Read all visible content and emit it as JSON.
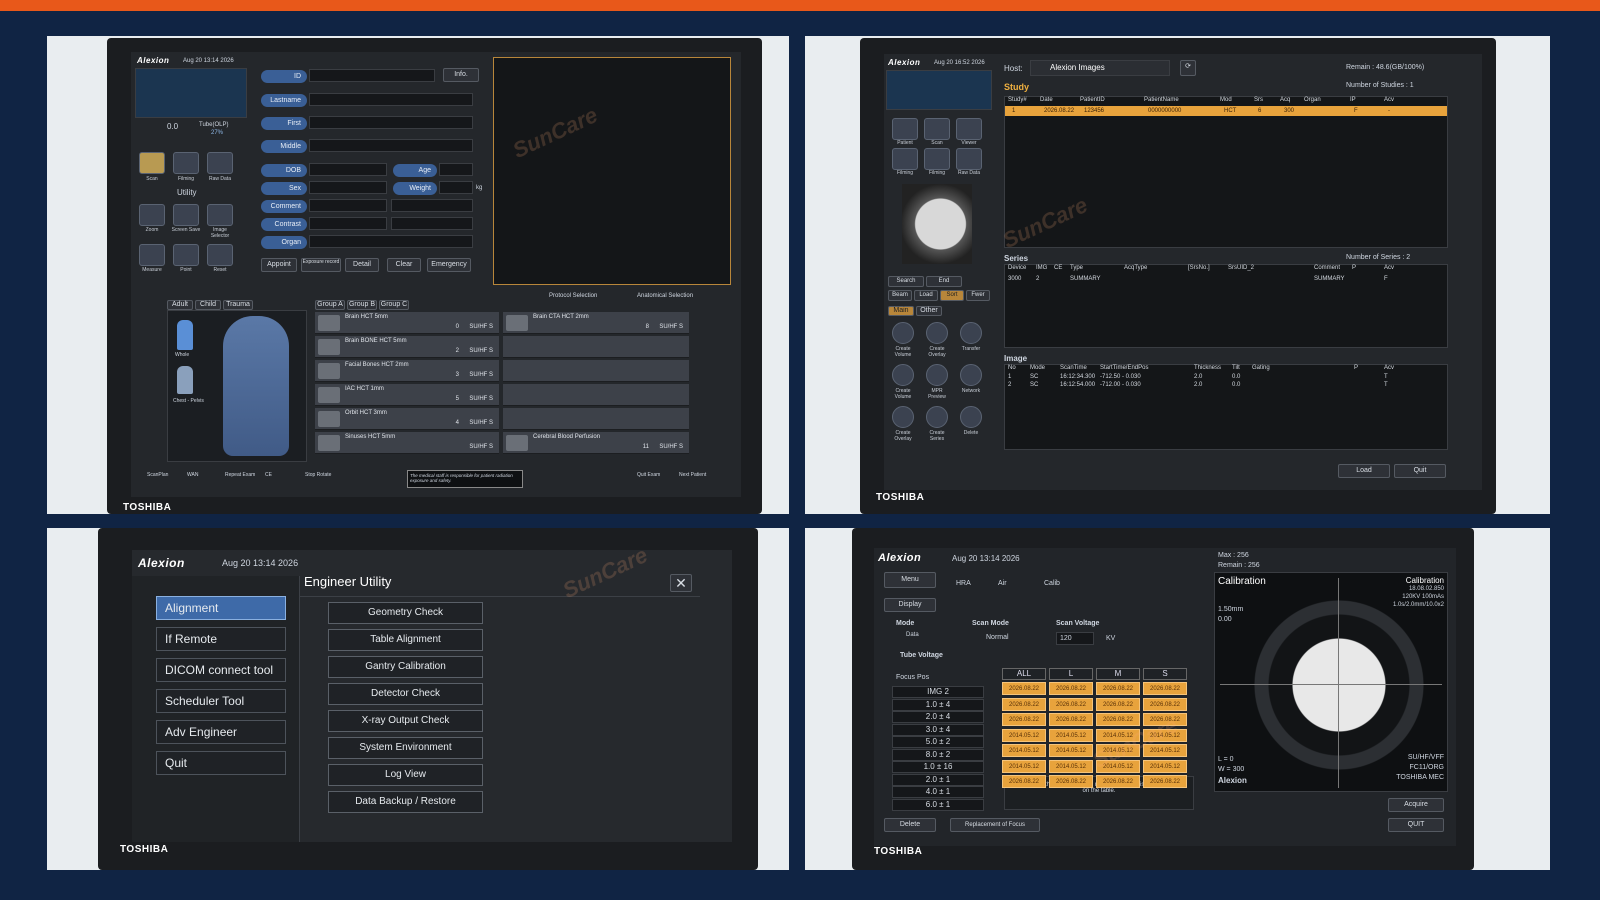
{
  "q1": {
    "brand": "Alexion",
    "datetime": "Aug 20 13:14 2026",
    "status": [
      "0.0",
      "Tube(OLP)",
      "27%"
    ],
    "utility_label": "Utility",
    "nav_icons": [
      "Scan",
      "Filming",
      "Raw Data"
    ],
    "tool_icons": [
      "Zoom",
      "Screen Save",
      "Image Selector",
      "Measure",
      "Point",
      "Reset"
    ],
    "fields": {
      "id": "ID",
      "lastname": "Lastname",
      "first": "First",
      "middle": "Middle",
      "dob": "DOB",
      "age": "Age",
      "sex": "Sex",
      "weight": "Weight",
      "weight_unit": "kg",
      "comment": "Comment",
      "contrast": "Contrast",
      "organ": "Organ"
    },
    "info_btn": "Info.",
    "actions": [
      "Appoint",
      "Exposure record",
      "Detail",
      "Clear",
      "Emergency"
    ],
    "body_tabs": [
      "Adult",
      "Child",
      "Trauma"
    ],
    "body_labels": [
      "Whole",
      "Chest - Pelvis"
    ],
    "group_tabs": [
      "Group A",
      "Group B",
      "Group C"
    ],
    "selection": [
      "Protocol Selection",
      "Anatomical Selection"
    ],
    "protocols_left": [
      {
        "name": "Brain  HCT 5mm",
        "n": "0",
        "s": "SU/HF  S"
      },
      {
        "name": "Brain  BONE HCT 5mm",
        "n": "2",
        "s": "SU/HF  S"
      },
      {
        "name": "Facial Bones HCT 2mm",
        "n": "3",
        "s": "SU/HF  S"
      },
      {
        "name": "IAC HCT 1mm",
        "n": "5",
        "s": "SU/HF  S"
      },
      {
        "name": "Orbit  HCT 3mm",
        "n": "4",
        "s": "SU/HF  S"
      },
      {
        "name": "Sinuses HCT 5mm",
        "n": "",
        "s": "SU/HF  S"
      }
    ],
    "protocols_right": [
      {
        "name": "Brain CTA HCT 2mm",
        "n": "8",
        "s": "SU/HF  S"
      },
      {
        "name": "",
        "n": "",
        "s": ""
      },
      {
        "name": "",
        "n": "",
        "s": ""
      },
      {
        "name": "",
        "n": "",
        "s": ""
      },
      {
        "name": "",
        "n": "",
        "s": ""
      },
      {
        "name": "Cerebral Blood Perfusion",
        "n": "11",
        "s": "SU/HF  S"
      }
    ],
    "bottom": [
      "ScanPlan",
      "WAN",
      "Repeat Exam",
      "CE",
      "Stop Rotate",
      "Quit Exam",
      "Next Patient"
    ],
    "notice": "The medical staff is responsible for patient radiation exposure and safety.",
    "maker": "TOSHIBA"
  },
  "q2": {
    "brand": "Alexion",
    "datetime": "Aug 20 16:52 2026",
    "host_label": "Host:",
    "host_value": "Alexion  Images",
    "remain": "Remain : 48.6(GB/100%)",
    "study_title": "Study",
    "studies_count": "Number of Studies :  1",
    "study_cols": [
      "Study#",
      "Date",
      "PatientID",
      "PatientName",
      "Mod",
      "Srs",
      "Acq",
      "Organ",
      "IP",
      "Acv"
    ],
    "study_row": [
      "1",
      "2026.08.22",
      "123456",
      "0000000000",
      "HCT",
      "6",
      "300",
      "",
      "F",
      "-"
    ],
    "nav_icons": [
      "Patient",
      "Scan",
      "Viewer",
      "Filming",
      "Filming",
      "Raw Data"
    ],
    "search_btns": [
      "Search",
      "End",
      "Beam",
      "Load",
      "Sort",
      "Fwer"
    ],
    "tabs": [
      "Main",
      "Other"
    ],
    "tools": [
      "Create Volume",
      "Create Overlay",
      "Transfer",
      "Create Volume",
      "MPR Preview",
      "Network",
      "Create Overlay",
      "Create Series",
      "Delete"
    ],
    "series_title": "Series",
    "series_count": "Number of Series :  2",
    "series_cols": [
      "Device",
      "IMG",
      "CE",
      "Type",
      "AcqType",
      "[SrsNo.]",
      "SrsUID_2",
      "Comment",
      "P",
      "Acv"
    ],
    "series_row": [
      "3000",
      "2",
      "",
      "SUMMARY",
      "",
      "",
      "",
      "SUMMARY",
      "",
      "F"
    ],
    "image_title": "Image",
    "image_cols": [
      "No",
      "Mode",
      "ScanTime",
      "StartTime/EndPos",
      "Thickness",
      "Tilt",
      "Gating",
      "P",
      "Acv"
    ],
    "image_rows": [
      [
        "1",
        "SC",
        "16:12:34.300",
        "-712.50 - 0.030",
        "2.0",
        "0.0",
        "",
        "",
        "T"
      ],
      [
        "2",
        "SC",
        "16:12:54.000",
        "-712.00 - 0.030",
        "2.0",
        "0.0",
        "",
        "",
        "T"
      ]
    ],
    "load_btn": "Load",
    "quit_btn": "Quit",
    "maker": "TOSHIBA"
  },
  "q3": {
    "brand": "Alexion",
    "datetime": "Aug 20 13:14 2026",
    "title": "Engineer Utility",
    "menu": [
      "Alignment",
      "If Remote",
      "DICOM connect tool",
      "Scheduler Tool",
      "Adv Engineer",
      "Quit"
    ],
    "utilities": [
      "Geometry Check",
      "Table Alignment",
      "Gantry Calibration",
      "Detector Check",
      "X-ray Output Check",
      "System Environment",
      "Log View",
      "Data Backup / Restore"
    ],
    "maker": "TOSHIBA"
  },
  "q4": {
    "brand": "Alexion",
    "datetime": "Aug 20 13:14 2026",
    "max": "Max : 256",
    "remain": "Remain : 256",
    "menu_btn": "Menu",
    "radios": [
      "HRA",
      "Air",
      "Calib"
    ],
    "display_btn": "Display",
    "mode_label": "Mode",
    "mode_value": "Data",
    "scan_mode_label": "Scan Mode",
    "scan_mode_value": "Normal",
    "voltage_label": "Scan Voltage",
    "voltage_value": "120",
    "voltage_unit": "KV",
    "tube_voltage": "Tube Voltage",
    "focus_pos": "Focus Pos",
    "focus_rows": [
      "IMG  2",
      "1.0 ± 4",
      "2.0 ± 4",
      "3.0 ± 4",
      "5.0 ± 2",
      "8.0 ± 2",
      "1.0 ± 16",
      "2.0 ± 1",
      "4.0 ± 1",
      "6.0 ± 1"
    ],
    "col_headers": [
      "ALL",
      "L",
      "M",
      "S"
    ],
    "grid": [
      [
        "2026.08.22",
        "2026.08.22",
        "2026.08.22",
        "2026.08.22"
      ],
      [
        "2026.08.22",
        "2026.08.22",
        "2026.08.22",
        "2026.08.22"
      ],
      [
        "2026.08.22",
        "2026.08.22",
        "2026.08.22",
        "2026.08.22"
      ],
      [
        "2014.05.12",
        "2014.05.12",
        "2014.05.12",
        "2014.05.12"
      ],
      [
        "2014.05.12",
        "2014.05.12",
        "2014.05.12",
        "2014.05.12"
      ],
      [
        "2014.05.12",
        "2014.05.12",
        "2014.05.12",
        "2014.05.12"
      ],
      [
        "2026.08.22",
        "2026.08.22",
        "2026.08.22",
        "2026.08.22"
      ]
    ],
    "note": "During the data collection make sure there is no patient on the table.",
    "delete_btn": "Delete",
    "replace_btn": "Replacement of Focus",
    "calib_title": "Calibration",
    "calib_right": [
      "Calibration",
      "18.08.02.850",
      "120KV 100mAs",
      "1.0s/2.0mm/10.0x2"
    ],
    "calib_left": [
      "1.50mm",
      "0.00"
    ],
    "calib_bottom_left": [
      "L = 0",
      "W = 300",
      "Alexion"
    ],
    "calib_bottom_right": [
      "SU/HF/VFF",
      "FC11/ORG",
      "TOSHIBA MEC"
    ],
    "acquire_btn": "Acquire",
    "quit_btn": "QUIT",
    "maker": "TOSHIBA"
  },
  "watermark": "SunCare"
}
